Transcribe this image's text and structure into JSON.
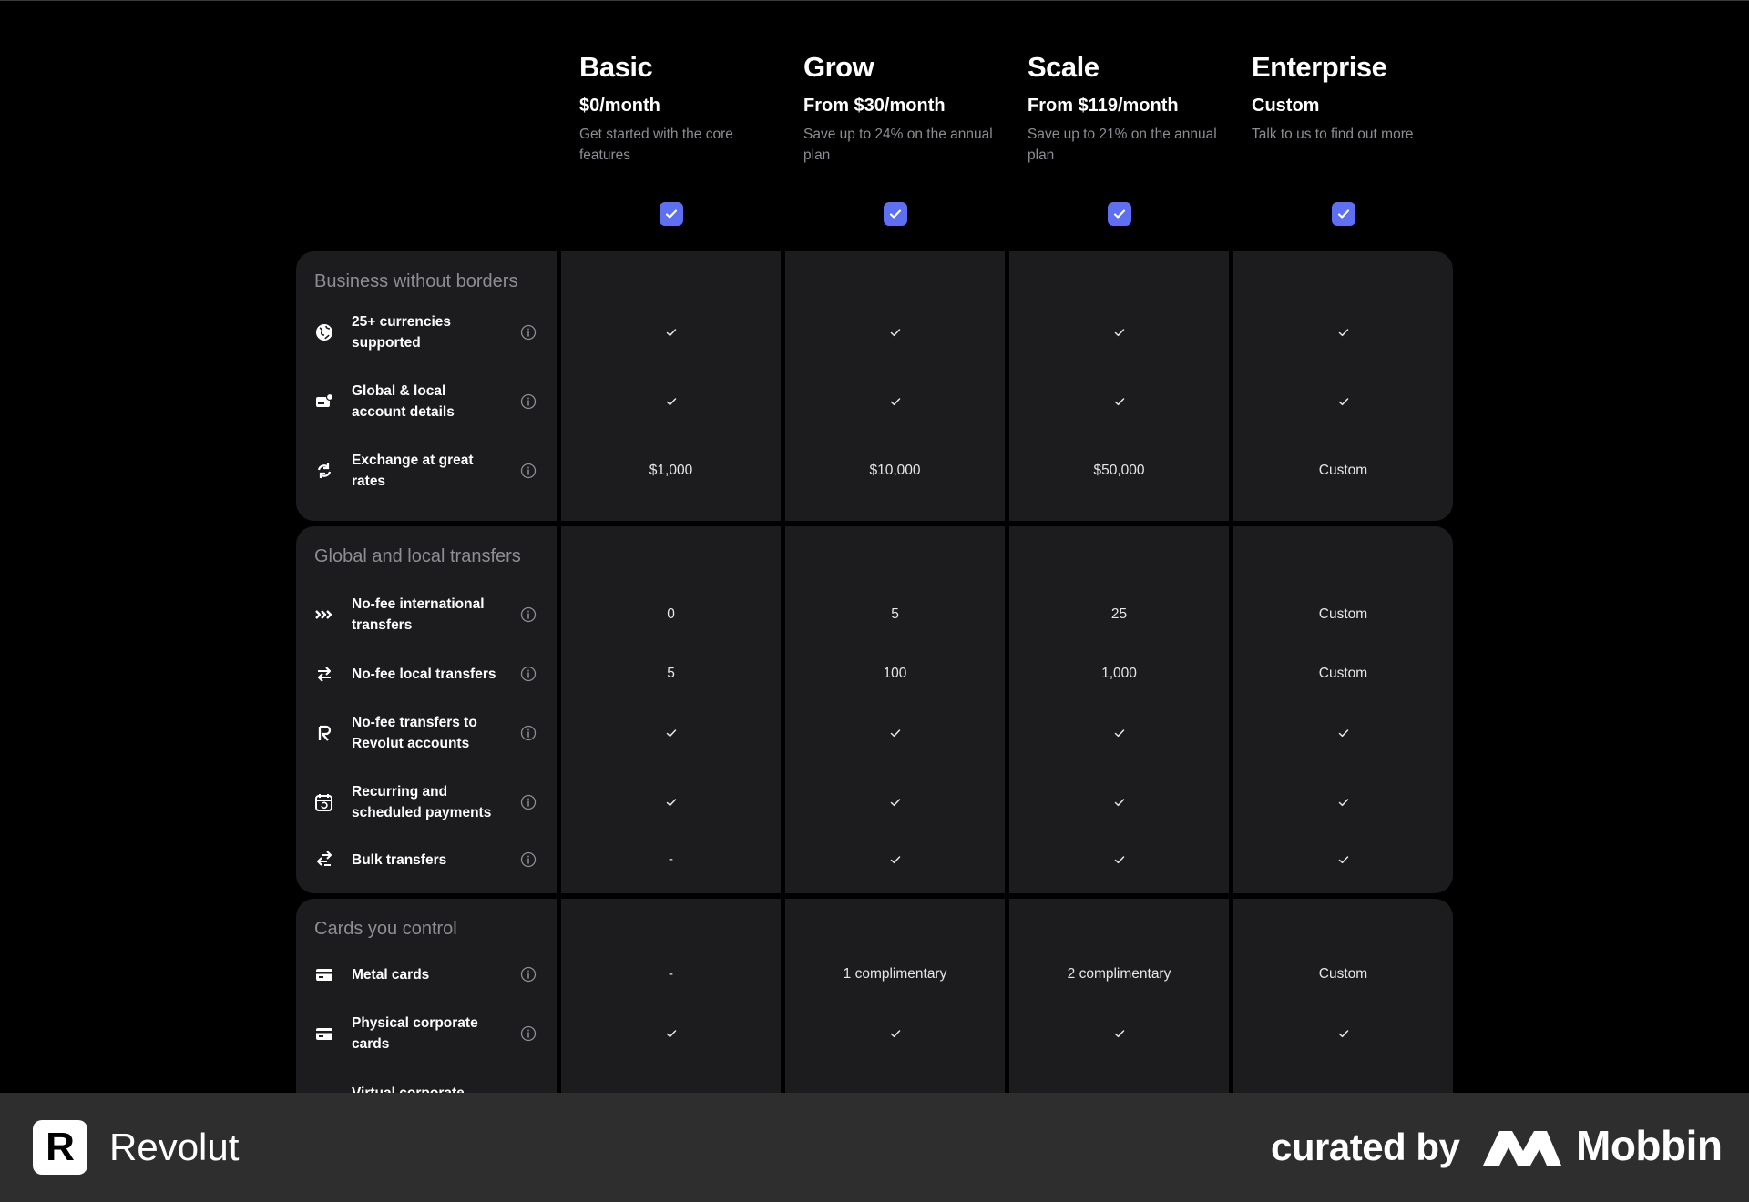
{
  "plans": [
    {
      "name": "Basic",
      "price": "$0/month",
      "description": "Get started with the core features"
    },
    {
      "name": "Grow",
      "price": "From $30/month",
      "description": "Save up to 24% on the annual plan"
    },
    {
      "name": "Scale",
      "price": "From $119/month",
      "description": "Save up to 21% on the annual plan"
    },
    {
      "name": "Enterprise",
      "price": "Custom",
      "description": "Talk to us to find out more"
    }
  ],
  "groups": [
    {
      "title": "Business without borders",
      "features": [
        {
          "label": "25+ currencies supported",
          "icon": "globe-icon",
          "values": [
            "check",
            "check",
            "check",
            "check"
          ]
        },
        {
          "label": "Global & local account details",
          "icon": "account-details-icon",
          "values": [
            "check",
            "check",
            "check",
            "check"
          ]
        },
        {
          "label": "Exchange at great rates",
          "icon": "exchange-icon",
          "values": [
            "$1,000",
            "$10,000",
            "$50,000",
            "Custom"
          ]
        }
      ]
    },
    {
      "title": "Global and local transfers",
      "features": [
        {
          "label": "No-fee international transfers",
          "icon": "international-transfer-icon",
          "values": [
            "0",
            "5",
            "25",
            "Custom"
          ]
        },
        {
          "label": "No-fee local transfers",
          "icon": "local-transfer-icon",
          "values": [
            "5",
            "100",
            "1,000",
            "Custom"
          ]
        },
        {
          "label": "No-fee transfers to Revolut accounts",
          "icon": "revolut-r-icon",
          "values": [
            "check",
            "check",
            "check",
            "check"
          ]
        },
        {
          "label": "Recurring and scheduled payments",
          "icon": "scheduled-payment-icon",
          "values": [
            "check",
            "check",
            "check",
            "check"
          ]
        },
        {
          "label": "Bulk transfers",
          "icon": "bulk-transfer-icon",
          "values": [
            "-",
            "check",
            "check",
            "check"
          ]
        }
      ]
    },
    {
      "title": "Cards you control",
      "features": [
        {
          "label": "Metal cards",
          "icon": "card-icon",
          "values": [
            "-",
            "1 complimentary",
            "2 complimentary",
            "Custom"
          ]
        },
        {
          "label": "Physical corporate cards",
          "icon": "card-icon",
          "values": [
            "check",
            "check",
            "check",
            "check"
          ]
        },
        {
          "label": "Virtual corporate",
          "icon": "virtual-card-icon",
          "values": []
        }
      ]
    }
  ],
  "footer": {
    "brand_logo_letter": "R",
    "brand_name": "Revolut",
    "curated_by": "curated by",
    "mobbin_name": "Mobbin"
  },
  "colors": {
    "background": "#000000",
    "card": "#1c1c1e",
    "accent": "#5d6ff2",
    "muted_text": "#8d8d93",
    "footer": "#2e2e2e"
  }
}
